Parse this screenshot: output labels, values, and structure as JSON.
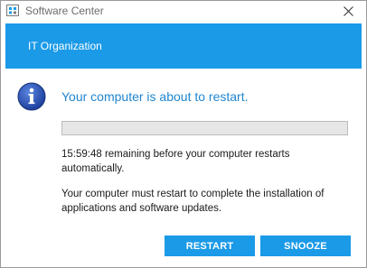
{
  "window": {
    "title": "Software Center"
  },
  "banner": {
    "organization": "IT Organization",
    "color": "#1b9ae7"
  },
  "dialog": {
    "icon": "info-icon",
    "heading": "Your computer is about to restart.",
    "progress": 0,
    "countdown_text": "15:59:48 remaining before your computer restarts automatically.",
    "explanation_text": "Your computer must restart to complete the installation of applications and software updates."
  },
  "buttons": {
    "restart_label": "RESTART",
    "snooze_label": "SNOOZE"
  }
}
